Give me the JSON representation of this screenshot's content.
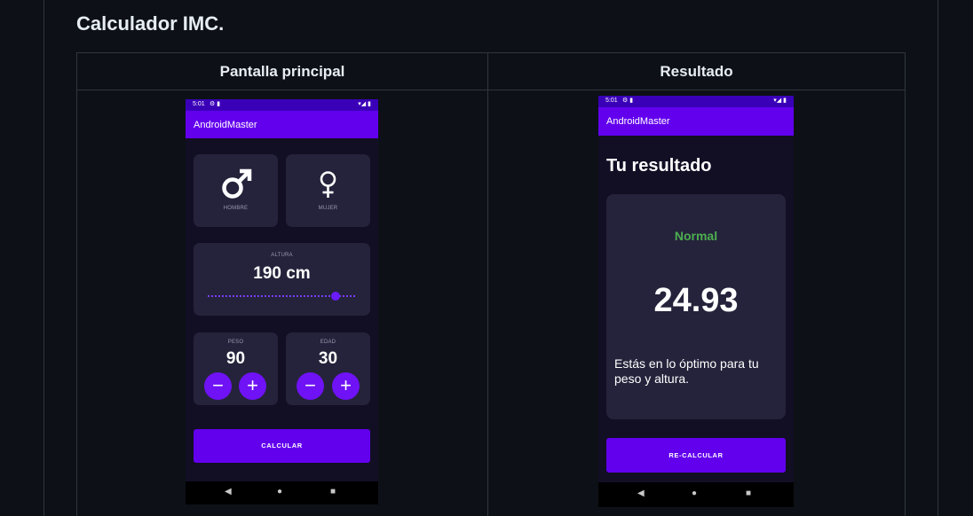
{
  "section_title": "Calculador IMC.",
  "table": {
    "col1_header": "Pantalla principal",
    "col2_header": "Resultado"
  },
  "main_screen": {
    "status_time": "5:01",
    "app_title": "AndroidMaster",
    "gender_male": {
      "icon": "male-icon",
      "label": "HOMBRE"
    },
    "gender_female": {
      "icon": "female-icon",
      "label": "MUJER"
    },
    "height_label": "ALTURA",
    "height_value": "190 cm",
    "height_slider_fraction": 0.84,
    "weight_label": "PESO",
    "weight_value": "90",
    "age_label": "EDAD",
    "age_value": "30",
    "minus_symbol": "−",
    "plus_symbol": "+",
    "calculate_button": "CALCULAR"
  },
  "result_screen": {
    "status_time": "5:01",
    "app_title": "AndroidMaster",
    "title": "Tu resultado",
    "status": "Normal",
    "status_color": "#4caf50",
    "value": "24.93",
    "description": "Estás en lo óptimo para tu peso y altura.",
    "recalculate_button": "RE-CALCULAR"
  },
  "navbar": {
    "back": "◀",
    "home": "●",
    "recents": "■"
  },
  "colors": {
    "accent": "#6200ee",
    "card": "#25233b",
    "background": "#120e24"
  }
}
